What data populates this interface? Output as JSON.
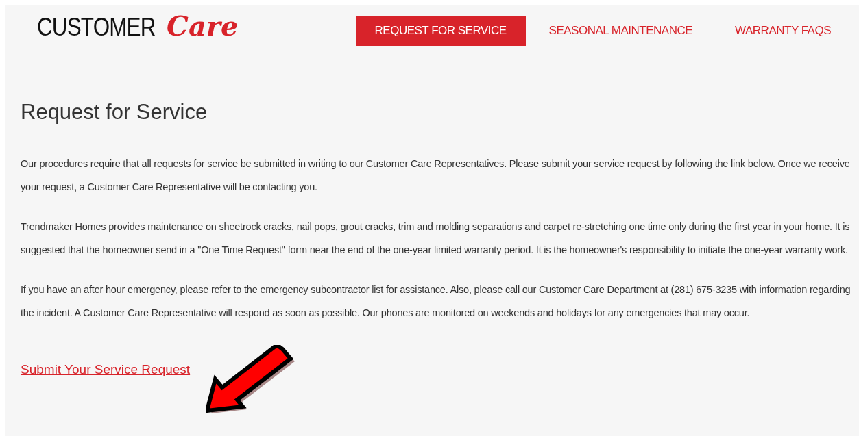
{
  "logo": {
    "word": "CUSTOMER",
    "script": "Care"
  },
  "nav": [
    {
      "label": "REQUEST FOR SERVICE",
      "selected": true
    },
    {
      "label": "SEASONAL MAINTENANCE",
      "selected": false
    },
    {
      "label": "WARRANTY FAQS",
      "selected": false
    }
  ],
  "heading": "Request for Service",
  "paragraphs": [
    "Our procedures require that all requests for service be submitted in writing to our Customer Care Representatives. Please submit your service request by following the link below. Once we receive your request, a Customer Care Representative will be contacting you.",
    "Trendmaker Homes provides maintenance on sheetrock cracks, nail pops, grout cracks, trim and molding separations and carpet re-stretching one time only during the first year in your home. It is suggested that the homeowner send in a \"One Time Request\" form near the end of the one-year limited warranty period. It is the homeowner's responsibility to initiate the one-year warranty work.",
    "If you have an after hour emergency, please refer to the emergency subcontractor list for assistance. Also, please call our Customer Care Department at (281) 675-3235 with information regarding the incident. A Customer Care Representative will respond as soon as possible. Our phones are monitored on weekends and holidays for any emergencies that may occur."
  ],
  "link": "Submit Your Service Request"
}
